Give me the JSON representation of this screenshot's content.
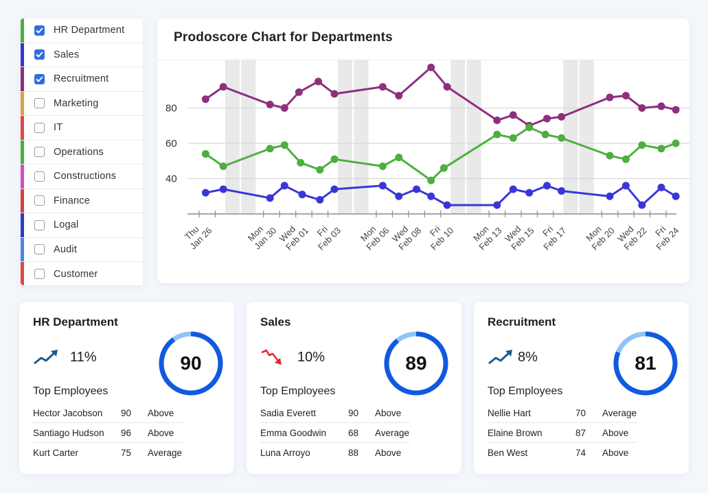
{
  "sidebar": {
    "items": [
      {
        "label": "HR Department",
        "checked": true,
        "color": "#4caf3e"
      },
      {
        "label": "Sales",
        "checked": true,
        "color": "#3535c8"
      },
      {
        "label": "Recruitment",
        "checked": true,
        "color": "#8e2f7e"
      },
      {
        "label": "Marketing",
        "checked": false,
        "color": "#d0a544"
      },
      {
        "label": "IT",
        "checked": false,
        "color": "#e04848"
      },
      {
        "label": "Operations",
        "checked": false,
        "color": "#4caf3e"
      },
      {
        "label": "Constructions",
        "checked": false,
        "color": "#d24ec0"
      },
      {
        "label": "Finance",
        "checked": false,
        "color": "#d24040"
      },
      {
        "label": "Logal",
        "checked": false,
        "color": "#3535c8"
      },
      {
        "label": "Audit",
        "checked": false,
        "color": "#4a86e0"
      },
      {
        "label": "Customer",
        "checked": false,
        "color": "#e04848"
      }
    ]
  },
  "chart": {
    "title": "Prodoscore Chart for Departments"
  },
  "chart_data": {
    "type": "line",
    "title": "Prodoscore Chart for Departments",
    "xlabel": "",
    "ylabel": "",
    "ylim": [
      20,
      105
    ],
    "y_ticks": [
      40,
      60,
      80
    ],
    "grid": true,
    "legend": "sidebar-left",
    "x_range_days": [
      "2023-01-26",
      "2023-02-24"
    ],
    "x_tick_labels": [
      {
        "day": 0,
        "line1": "Thu",
        "line2": "Jan 26"
      },
      {
        "day": 4,
        "line1": "Mon",
        "line2": "Jan 30"
      },
      {
        "day": 6,
        "line1": "Wed",
        "line2": "Feb 01"
      },
      {
        "day": 8,
        "line1": "Fri",
        "line2": "Feb 03"
      },
      {
        "day": 11,
        "line1": "Mon",
        "line2": "Feb 06"
      },
      {
        "day": 13,
        "line1": "Wed",
        "line2": "Feb 08"
      },
      {
        "day": 15,
        "line1": "Fri",
        "line2": "Feb 10"
      },
      {
        "day": 18,
        "line1": "Mon",
        "line2": "Feb 13"
      },
      {
        "day": 20,
        "line1": "Wed",
        "line2": "Feb 15"
      },
      {
        "day": 22,
        "line1": "Fri",
        "line2": "Feb 17"
      },
      {
        "day": 25,
        "line1": "Mon",
        "line2": "Feb 20"
      },
      {
        "day": 27,
        "line1": "Wed",
        "line2": "Feb 22"
      },
      {
        "day": 29,
        "line1": "Fri",
        "line2": "Feb 24"
      }
    ],
    "weekend_days": [
      2,
      3,
      9,
      10,
      16,
      17,
      23,
      24
    ],
    "series": [
      {
        "name": "Recruitment",
        "color": "#8e2f7e",
        "points": [
          [
            0.4,
            85
          ],
          [
            1.5,
            92
          ],
          [
            4.4,
            82
          ],
          [
            5.3,
            80
          ],
          [
            6.2,
            89
          ],
          [
            7.4,
            95
          ],
          [
            8.4,
            88
          ],
          [
            11.4,
            92
          ],
          [
            12.4,
            87
          ],
          [
            14.4,
            103
          ],
          [
            15.4,
            92
          ],
          [
            18.5,
            73
          ],
          [
            19.5,
            76
          ],
          [
            20.5,
            70
          ],
          [
            21.6,
            74
          ],
          [
            22.5,
            75
          ],
          [
            25.5,
            86
          ],
          [
            26.5,
            87
          ],
          [
            27.5,
            80
          ],
          [
            28.7,
            81
          ],
          [
            29.6,
            79
          ]
        ]
      },
      {
        "name": "HR Department",
        "color": "#4caf3e",
        "points": [
          [
            0.4,
            54
          ],
          [
            1.5,
            47
          ],
          [
            4.4,
            57
          ],
          [
            5.3,
            59
          ],
          [
            6.3,
            49
          ],
          [
            7.5,
            45
          ],
          [
            8.4,
            51
          ],
          [
            11.4,
            47
          ],
          [
            12.4,
            52
          ],
          [
            14.4,
            39
          ],
          [
            15.2,
            46
          ],
          [
            18.5,
            65
          ],
          [
            19.5,
            63
          ],
          [
            20.5,
            69
          ],
          [
            21.5,
            65
          ],
          [
            22.5,
            63
          ],
          [
            25.5,
            53
          ],
          [
            26.5,
            51
          ],
          [
            27.5,
            59
          ],
          [
            28.7,
            57
          ],
          [
            29.6,
            60
          ]
        ]
      },
      {
        "name": "Sales",
        "color": "#3a36d6",
        "points": [
          [
            0.4,
            32
          ],
          [
            1.5,
            34
          ],
          [
            4.4,
            29
          ],
          [
            5.3,
            36
          ],
          [
            6.4,
            31
          ],
          [
            7.5,
            28
          ],
          [
            8.4,
            34
          ],
          [
            11.4,
            36
          ],
          [
            12.4,
            30
          ],
          [
            13.5,
            34
          ],
          [
            14.4,
            30
          ],
          [
            15.4,
            25
          ],
          [
            18.5,
            25
          ],
          [
            19.5,
            34
          ],
          [
            20.5,
            32
          ],
          [
            21.6,
            36
          ],
          [
            22.5,
            33
          ],
          [
            25.5,
            30
          ],
          [
            26.5,
            36
          ],
          [
            27.5,
            25
          ],
          [
            28.7,
            35
          ],
          [
            29.6,
            30
          ]
        ]
      }
    ]
  },
  "cards": [
    {
      "title": "HR Department",
      "trend": "up",
      "trend_value": "11%",
      "score": "90",
      "score_fraction": 0.9,
      "top_title": "Top Employees",
      "employees": [
        {
          "name": "Hector Jacobson",
          "score": "90",
          "rating": "Above"
        },
        {
          "name": "Santiago Hudson",
          "score": "96",
          "rating": "Above"
        },
        {
          "name": "Kurt Carter",
          "score": "75",
          "rating": "Average"
        }
      ]
    },
    {
      "title": "Sales",
      "trend": "down",
      "trend_value": "10%",
      "score": "89",
      "score_fraction": 0.89,
      "top_title": "Top Employees",
      "employees": [
        {
          "name": "Sadia Everett",
          "score": "90",
          "rating": "Above"
        },
        {
          "name": "Emma Goodwin",
          "score": "68",
          "rating": "Average"
        },
        {
          "name": "Luna Arroyo",
          "score": "88",
          "rating": "Above"
        }
      ]
    },
    {
      "title": "Recruitment",
      "trend": "up",
      "trend_value": "8%",
      "score": "81",
      "score_fraction": 0.81,
      "top_title": "Top Employees",
      "employees": [
        {
          "name": "Nellie Hart",
          "score": "70",
          "rating": "Average"
        },
        {
          "name": "Elaine Brown",
          "score": "87",
          "rating": "Above"
        },
        {
          "name": "Ben West",
          "score": "74",
          "rating": "Above"
        }
      ]
    }
  ],
  "colors": {
    "gauge_fill": "#1159e0",
    "gauge_track": "#8fc4f5",
    "trend_up": "#1a5a8e",
    "trend_down": "#e8242e",
    "checkbox_checked": "#2f6de1"
  }
}
